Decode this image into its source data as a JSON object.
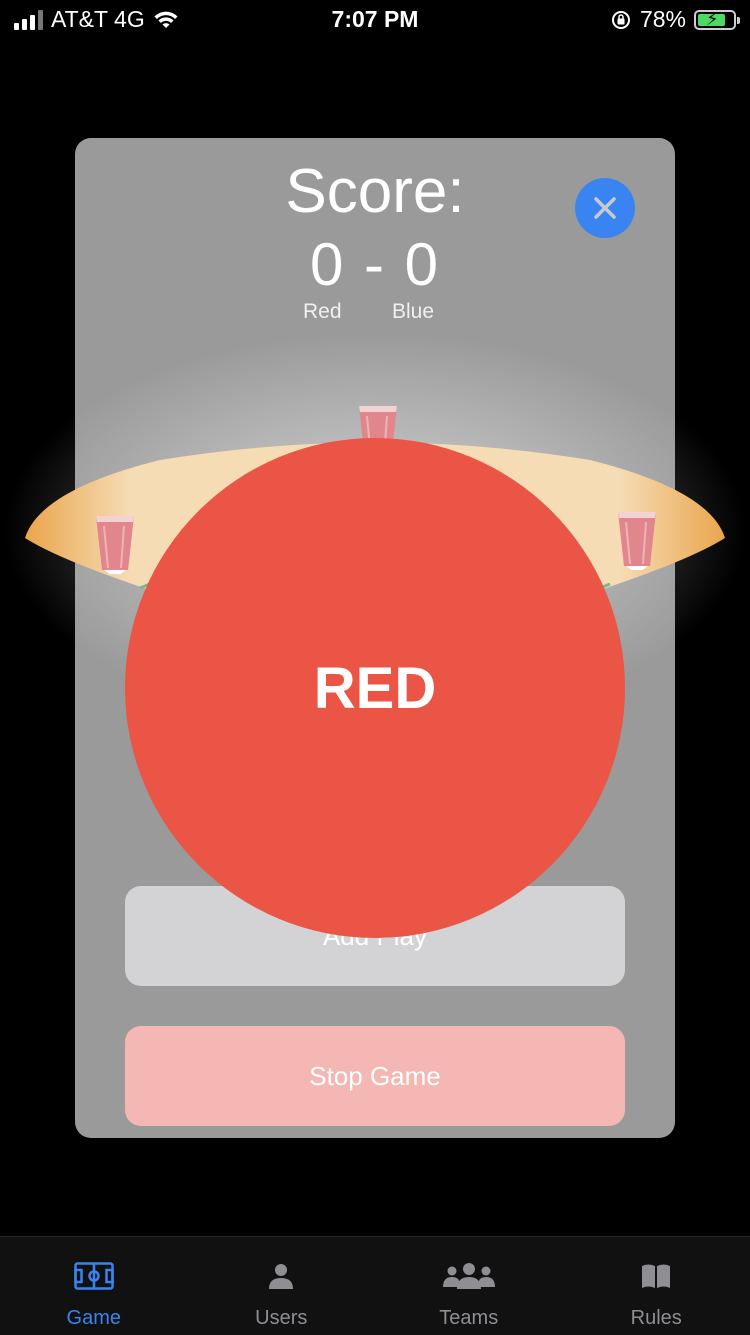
{
  "status_bar": {
    "carrier": "AT&T 4G",
    "time": "7:07 PM",
    "battery_percent": "78%",
    "icons": [
      "signal-icon",
      "wifi-icon",
      "orientation-lock-icon",
      "battery-charging-icon"
    ]
  },
  "score": {
    "title": "Score:",
    "value": "0 - 0",
    "red_label": "Red",
    "blue_label": "Blue"
  },
  "turn_indicator": {
    "label": "RED",
    "color": "#eb5545"
  },
  "buttons": {
    "add_play": "Add Play",
    "stop_game": "Stop Game",
    "close_icon": "close-icon"
  },
  "tabs": [
    {
      "label": "Game",
      "icon": "field-icon",
      "active": true
    },
    {
      "label": "Users",
      "icon": "person-icon",
      "active": false
    },
    {
      "label": "Teams",
      "icon": "group-icon",
      "active": false
    },
    {
      "label": "Rules",
      "icon": "book-icon",
      "active": false
    }
  ],
  "colors": {
    "accent": "#3a84f1",
    "red": "#eb5545",
    "table": "#f5dcb5",
    "table_edge": "#eaa54c"
  }
}
